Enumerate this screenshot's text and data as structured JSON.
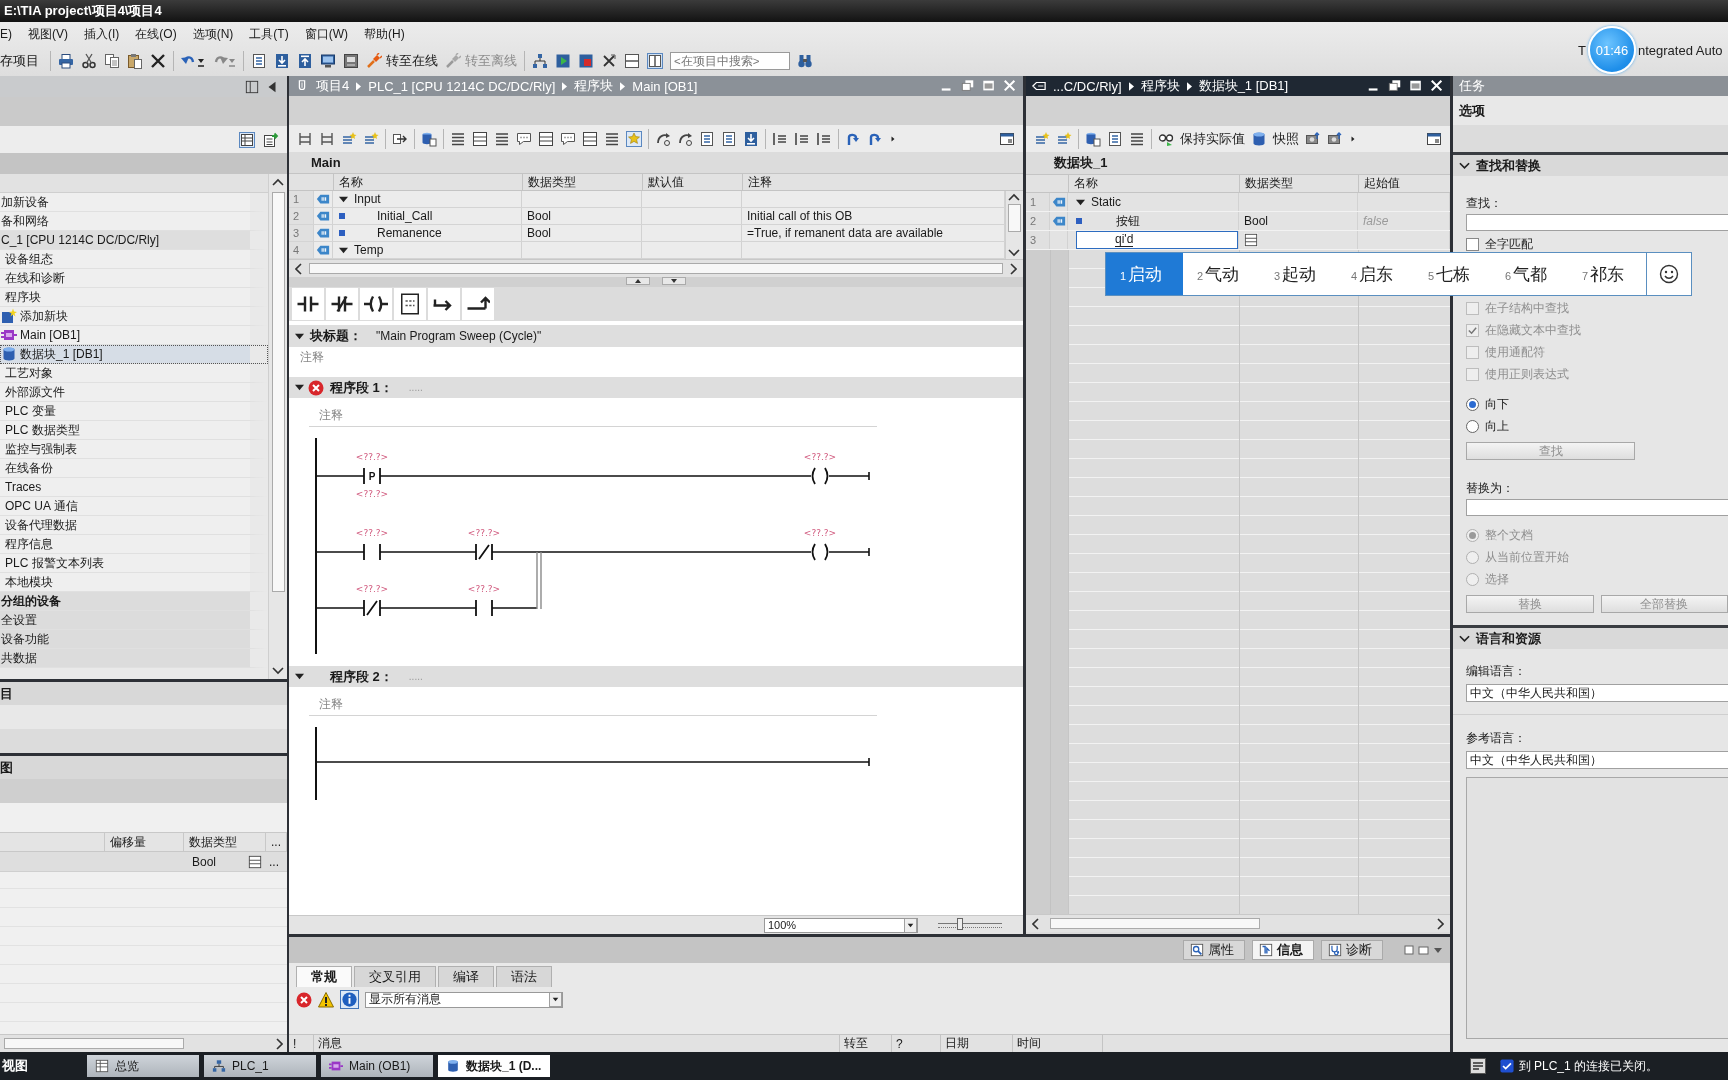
{
  "window": {
    "title": "E:\\TIA project\\项目4\\项目4"
  },
  "menu": [
    "E)",
    "视图(V)",
    "插入(I)",
    "在线(O)",
    "选项(N)",
    "工具(T)",
    "窗口(W)",
    "帮助(H)"
  ],
  "toolbar": {
    "save_label": "存项目",
    "go_online": {
      "label": "转至在线",
      "disabled": false
    },
    "go_offline": {
      "label": "转至离线",
      "disabled": true
    },
    "search": {
      "placeholder": "<在项目中搜索>"
    }
  },
  "brand": {
    "left": "T",
    "right": "ntegrated Auto",
    "timer": "01:46"
  },
  "project_tree": {
    "items": [
      {
        "label": "加新设备",
        "kind": "item",
        "selected": false
      },
      {
        "label": "备和网络",
        "kind": "item",
        "selected": false
      },
      {
        "label": "C_1 [CPU 1214C DC/DC/Rly]",
        "kind": "device",
        "selected": false,
        "children": [
          {
            "label": "设备组态",
            "kind": "item",
            "selected": false
          },
          {
            "label": "在线和诊断",
            "kind": "item",
            "selected": false
          },
          {
            "label": "程序块",
            "kind": "item",
            "selected": false,
            "children": [
              {
                "label": "添加新块",
                "kind": "add_block",
                "selected": false
              },
              {
                "label": "Main [OB1]",
                "kind": "ob_block",
                "selected": false
              },
              {
                "label": "数据块_1 [DB1]",
                "kind": "db_block",
                "selected": true
              }
            ]
          },
          {
            "label": "工艺对象",
            "kind": "item",
            "selected": false
          },
          {
            "label": "外部源文件",
            "kind": "item",
            "selected": false
          },
          {
            "label": "PLC 变量",
            "kind": "item",
            "selected": false
          },
          {
            "label": "PLC 数据类型",
            "kind": "item",
            "selected": false
          },
          {
            "label": "监控与强制表",
            "kind": "item",
            "selected": false
          },
          {
            "label": "在线备份",
            "kind": "item",
            "selected": false
          },
          {
            "label": "Traces",
            "kind": "item",
            "selected": false
          },
          {
            "label": "OPC UA 通信",
            "kind": "item",
            "selected": false
          },
          {
            "label": "设备代理数据",
            "kind": "item",
            "selected": false
          },
          {
            "label": "程序信息",
            "kind": "item",
            "selected": false
          },
          {
            "label": "PLC 报警文本列表",
            "kind": "item",
            "selected": false
          },
          {
            "label": "本地模块",
            "kind": "item",
            "selected": false
          }
        ]
      },
      {
        "label": "分组的设备",
        "kind": "group",
        "selected": false
      },
      {
        "label": "全设置",
        "kind": "section",
        "selected": false
      },
      {
        "label": "设备功能",
        "kind": "section",
        "selected": false
      },
      {
        "label": "共数据",
        "kind": "section",
        "selected": false
      }
    ]
  },
  "reference_panel": {
    "title": "目"
  },
  "detail_panel": {
    "title": "图",
    "columns": [
      "偏移量",
      "数据类型",
      "..."
    ],
    "rows": [
      {
        "data_type": "Bool",
        "more": "..."
      }
    ]
  },
  "ob_editor": {
    "active": false,
    "breadcrumb": [
      "项目4",
      "PLC_1 [CPU 1214C DC/DC/Rly]",
      "程序块",
      "Main [OB1]"
    ],
    "block_name": "Main",
    "columns": [
      "名称",
      "数据类型",
      "默认值",
      "注释"
    ],
    "rows": [
      {
        "num": "1",
        "kind": "section",
        "name": "Input",
        "expanded": true
      },
      {
        "num": "2",
        "kind": "param",
        "name": "Initial_Call",
        "type": "Bool",
        "comment": "Initial call of this OB"
      },
      {
        "num": "3",
        "kind": "param",
        "name": "Remanence",
        "type": "Bool",
        "comment": "=True, if remanent data are available"
      },
      {
        "num": "4",
        "kind": "section",
        "name": "Temp",
        "expanded": true
      }
    ],
    "block_title": {
      "label": "块标题：",
      "value": "\"Main Program Sweep (Cycle)\"",
      "comment": "注释",
      "expanded": true
    },
    "networks": [
      {
        "title": "程序段 1：",
        "dots": ".....",
        "error": true,
        "expanded": true,
        "comment": "注释",
        "rungs": [
          {
            "elements": [
              {
                "kind": "p_contact",
                "symbol": "P",
                "operand": "<??.?>",
                "edge_operand": "<??.?>"
              },
              {
                "kind": "coil",
                "operand": "<??.?>"
              }
            ]
          },
          {
            "elements": [
              {
                "kind": "no_contact",
                "operand": "<??.?>"
              },
              {
                "kind": "nc_contact",
                "operand": "<??.?>"
              },
              {
                "kind": "coil",
                "operand": "<??.?>"
              }
            ],
            "branch": [
              {
                "kind": "nc_contact",
                "operand": "<??.?>"
              },
              {
                "kind": "no_contact",
                "operand": "<??.?>"
              }
            ]
          }
        ]
      },
      {
        "title": "程序段 2：",
        "dots": ".....",
        "error": false,
        "expanded": true,
        "comment": "注释"
      }
    ],
    "zoom": {
      "value": "100%",
      "level": 0.35
    }
  },
  "db_editor": {
    "active": true,
    "breadcrumb": [
      "...C/DC/Rly]",
      "程序块",
      "数据块_1 [DB1]"
    ],
    "tools": {
      "keep_actual": "保持实际值",
      "snapshot": "快照"
    },
    "block_name": "数据块_1",
    "columns": [
      "名称",
      "数据类型",
      "起始值"
    ],
    "rows": [
      {
        "num": "1",
        "kind": "section",
        "name": "Static",
        "expanded": true
      },
      {
        "num": "2",
        "kind": "var",
        "name": "按钮",
        "type": "Bool",
        "start": "false"
      },
      {
        "num": "3",
        "kind": "editing",
        "value": "qi'd"
      }
    ]
  },
  "ime": {
    "candidates": [
      {
        "index": "1",
        "text": "启动",
        "selected": true
      },
      {
        "index": "2",
        "text": "气动",
        "selected": false
      },
      {
        "index": "3",
        "text": "起动",
        "selected": false
      },
      {
        "index": "4",
        "text": "启东",
        "selected": false
      },
      {
        "index": "5",
        "text": "七栋",
        "selected": false
      },
      {
        "index": "6",
        "text": "气都",
        "selected": false
      },
      {
        "index": "7",
        "text": "祁东",
        "selected": false
      }
    ]
  },
  "tasks": {
    "title": "任务",
    "options": "选项",
    "find_replace": {
      "title": "查找和替换",
      "expanded": true,
      "find_label": "查找：",
      "checks": [
        {
          "label": "全字匹配",
          "checked": false,
          "disabled": false
        },
        {
          "label": "在子结构中查找",
          "checked": false,
          "disabled": true
        },
        {
          "label": "在隐藏文本中查找",
          "checked": true,
          "disabled": true
        },
        {
          "label": "使用通配符",
          "checked": false,
          "disabled": true
        },
        {
          "label": "使用正则表达式",
          "checked": false,
          "disabled": true
        }
      ],
      "directions": [
        {
          "label": "向下",
          "selected": true,
          "disabled": false
        },
        {
          "label": "向上",
          "selected": false,
          "disabled": false
        }
      ],
      "find_button": {
        "label": "查找",
        "disabled": true
      },
      "replace_label": "替换为：",
      "scopes": [
        {
          "label": "整个文档",
          "selected": true,
          "disabled": true
        },
        {
          "label": "从当前位置开始",
          "selected": false,
          "disabled": true
        },
        {
          "label": "选择",
          "selected": false,
          "disabled": true
        }
      ],
      "replace_buttons": [
        {
          "label": "替换",
          "disabled": true
        },
        {
          "label": "全部替换",
          "disabled": true
        }
      ]
    },
    "language": {
      "title": "语言和资源",
      "expanded": true,
      "edit_label": "编辑语言：",
      "edit_value": "中文（中华人民共和国）",
      "ref_label": "参考语言：",
      "ref_value": "中文（中华人民共和国）"
    }
  },
  "inspector": {
    "panel_tabs": [
      {
        "label": "属性",
        "selected": false
      },
      {
        "label": "信息",
        "selected": true
      },
      {
        "label": "诊断",
        "selected": false
      }
    ],
    "tabs": [
      {
        "label": "常规",
        "selected": true
      },
      {
        "label": "交叉引用",
        "selected": false
      },
      {
        "label": "编译",
        "selected": false
      },
      {
        "label": "语法",
        "selected": false
      }
    ],
    "filter": "显示所有消息",
    "columns": [
      "!",
      "消息",
      "转至",
      "?",
      "日期",
      "时间"
    ]
  },
  "taskbar": {
    "portal": "视图",
    "tabs": [
      {
        "label": "总览",
        "kind": "overview",
        "selected": false
      },
      {
        "label": "PLC_1",
        "kind": "device",
        "selected": false
      },
      {
        "label": "Main (OB1)",
        "kind": "ob_block",
        "selected": false
      },
      {
        "label": "数据块_1 (D...",
        "kind": "db_block",
        "selected": true
      }
    ],
    "status": "到 PLC_1 的连接已关闭。"
  }
}
